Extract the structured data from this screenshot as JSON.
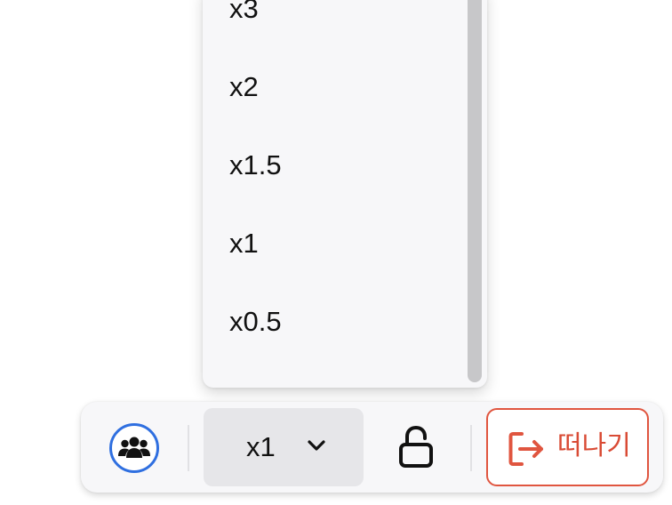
{
  "speed_menu": {
    "options": [
      "x3",
      "x2",
      "x1.5",
      "x1",
      "x0.5"
    ]
  },
  "toolbar": {
    "members_icon": "group-icon",
    "speed_value": "x1",
    "speed_chevron_icon": "chevron-down-icon",
    "lock_icon": "unlock-icon",
    "leave_icon": "exit-icon",
    "leave_label": "떠나기"
  },
  "colors": {
    "accent_blue": "#2f6fe0",
    "leave_red": "#e0553f",
    "panel_background": "#f7f7f9",
    "select_background": "#e6e6e9"
  }
}
